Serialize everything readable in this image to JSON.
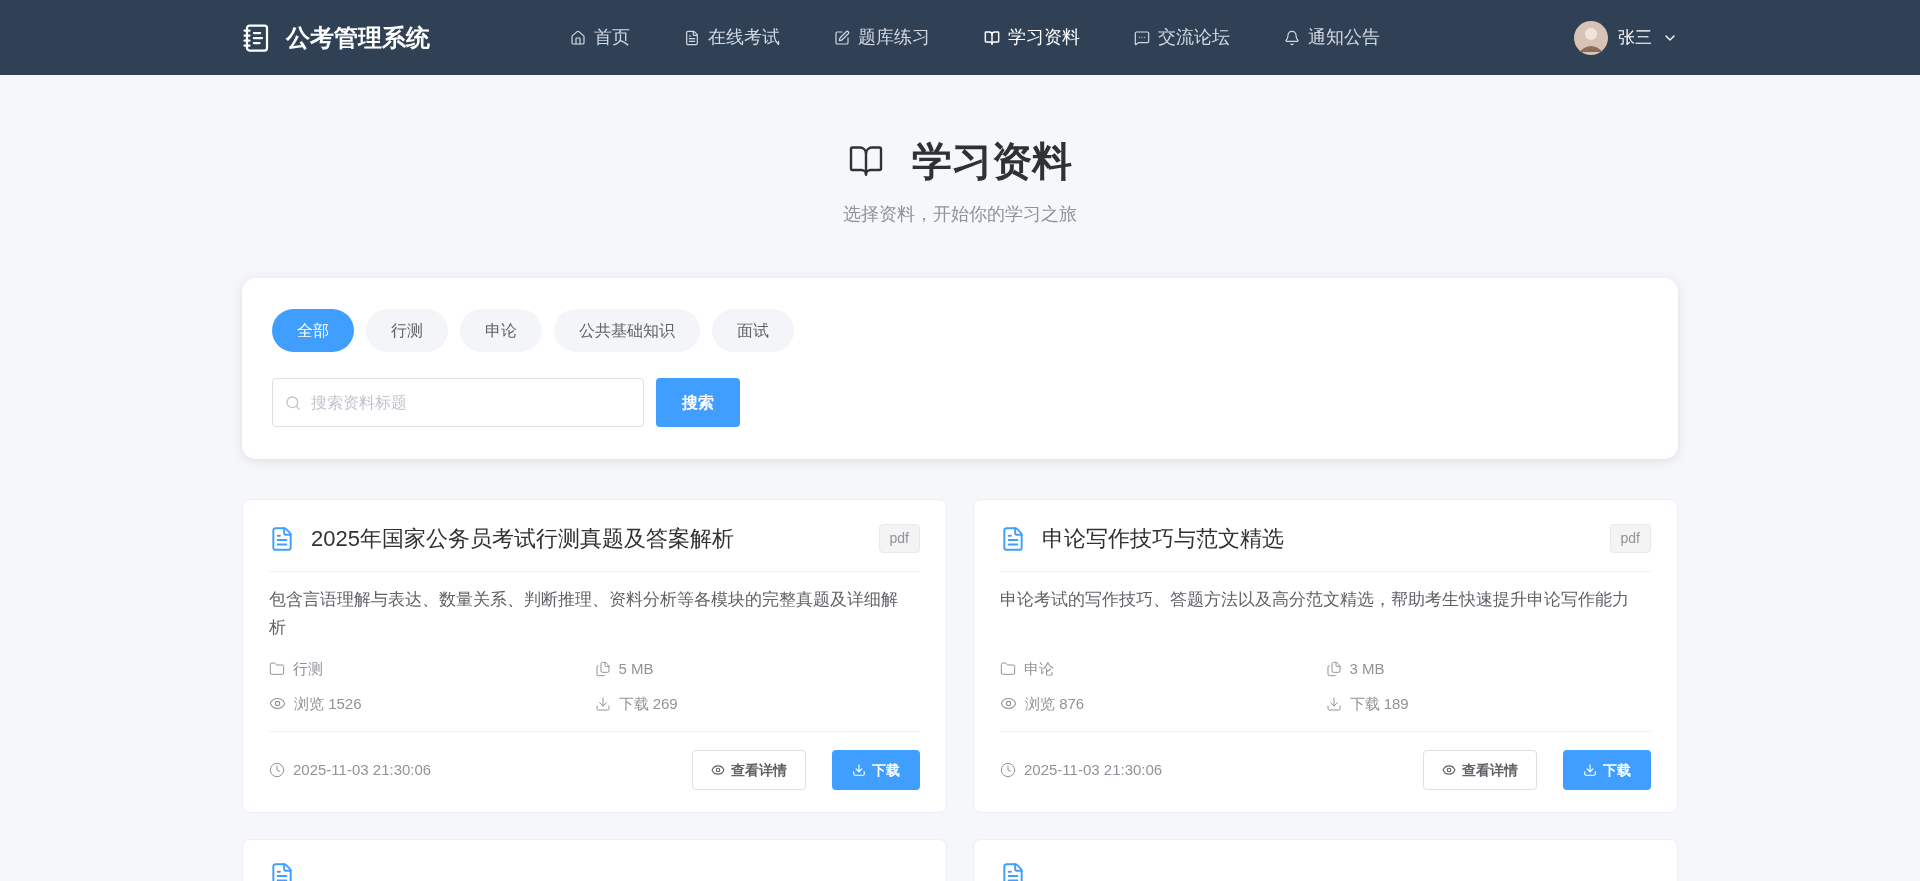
{
  "header": {
    "logo_text": "公考管理系统",
    "nav": [
      {
        "label": "首页",
        "selected": false
      },
      {
        "label": "在线考试",
        "selected": false
      },
      {
        "label": "题库练习",
        "selected": false
      },
      {
        "label": "学习资料",
        "selected": true
      },
      {
        "label": "交流论坛",
        "selected": false
      },
      {
        "label": "通知公告",
        "selected": false
      }
    ],
    "user": {
      "name": "张三"
    }
  },
  "hero": {
    "title": "学习资料",
    "subtitle": "选择资料，开始你的学习之旅"
  },
  "filters": {
    "categories": [
      {
        "label": "全部",
        "selected": true
      },
      {
        "label": "行测",
        "selected": false
      },
      {
        "label": "申论",
        "selected": false
      },
      {
        "label": "公共基础知识",
        "selected": false
      },
      {
        "label": "面试",
        "selected": false
      }
    ],
    "search": {
      "placeholder": "搜索资料标题"
    },
    "search_button": "搜索"
  },
  "materials": [
    {
      "title": "2025年国家公务员考试行测真题及答案解析",
      "format": "pdf",
      "description": "包含言语理解与表达、数量关系、判断推理、资料分析等各模块的完整真题及详细解析",
      "category": "行测",
      "size": "5 MB",
      "views": "浏览 1526",
      "downloads": "下载 269",
      "time": "2025-11-03 21:30:06",
      "detail_button": "查看详情",
      "download_button": "下载"
    },
    {
      "title": "申论写作技巧与范文精选",
      "format": "pdf",
      "description": "申论考试的写作技巧、答题方法以及高分范文精选，帮助考生快速提升申论写作能力",
      "category": "申论",
      "size": "3 MB",
      "views": "浏览 876",
      "downloads": "下载 189",
      "time": "2025-11-03 21:30:06",
      "detail_button": "查看详情",
      "download_button": "下载"
    }
  ],
  "more_materials": [
    {
      "kind": "cut"
    },
    {
      "kind": "cut"
    }
  ]
}
